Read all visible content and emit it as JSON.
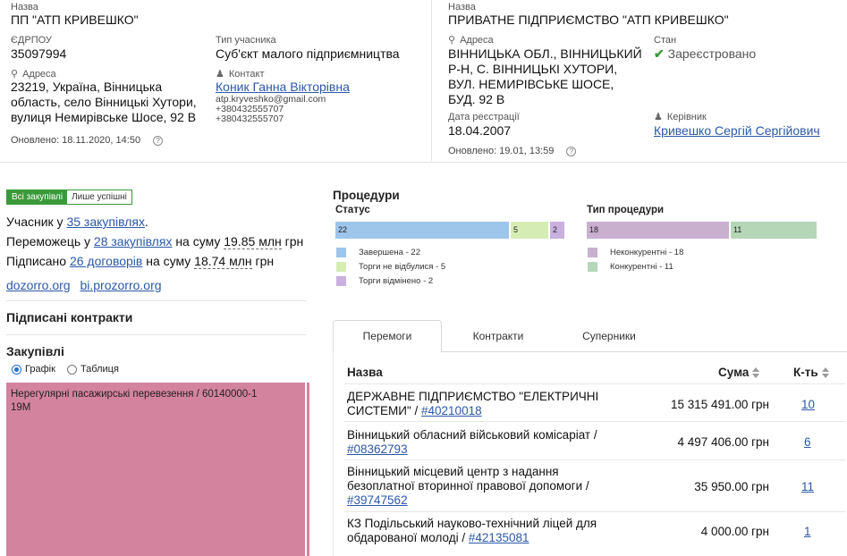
{
  "left_entity": {
    "name_label": "Назва",
    "name": "ПП \"АТП КРИВЕШКО\"",
    "edrpou_label": "ЄДРПОУ",
    "edrpou": "35097994",
    "participant_type_label": "Тип учасника",
    "participant_type": "Суб'єкт малого підприємництва",
    "address_label": "Адреса",
    "address_lines": [
      "23219, Україна, Вінницька",
      "область, село Вінницькі Хутори,",
      "вулиця Немирівське Шосе, 92 В"
    ],
    "contact_label": "Контакт",
    "contact_name": "Коник Ганна Вікторівна",
    "contact_email": "atp.kryveshko@gmail.com",
    "contact_phone_1": "+380432555707",
    "contact_phone_2": "+380432555707",
    "updated": "Оновлено: 18.11.2020, 14:50"
  },
  "right_entity": {
    "name_label": "Назва",
    "name": "ПРИВАТНЕ ПІДПРИЄМСТВО \"АТП КРИВЕШКО\"",
    "address_label": "Адреса",
    "address_lines": [
      "ВІННИЦЬКА ОБЛ., ВІННИЦЬКИЙ",
      "Р-Н, С. ВІННИЦЬКІ ХУТОРИ,",
      "ВУЛ. НЕМИРІВСЬКЕ ШОСЕ,",
      "БУД. 92 В"
    ],
    "state_label": "Стан",
    "state": "Зареєстровано",
    "reg_date_label": "Дата реєстрації",
    "reg_date": "18.04.2007",
    "head_label": "Керівник",
    "head_name": "Кривешко Сергій Сергійович",
    "updated": "Оновлено: 19.01, 13:59"
  },
  "filter": {
    "all": "Всі закупівлі",
    "success": "Лише успішні"
  },
  "stats": {
    "participant_prefix": "Учасник у",
    "participant_link": "35 закупівлях",
    "participant_suffix": ".",
    "winner_prefix": "Переможець у",
    "winner_link": "28 закупівлях",
    "winner_mid": "на суму",
    "winner_sum": "19.85 млн",
    "winner_currency": "грн",
    "signed_prefix": "Підписано",
    "signed_link": "26 договорів",
    "signed_mid": "на суму",
    "signed_sum": "18.74 млн",
    "signed_currency": "грн"
  },
  "links": {
    "dozorro": "dozorro.org",
    "bi": "bi.prozorro.org"
  },
  "signed_contracts_title": "Підписані контракти",
  "procurements": {
    "title": "Закупівлі",
    "view_chart": "Графік",
    "view_table": "Таблиця",
    "block_label": "Нерегулярні пасажирські перевезення / 60140000-1",
    "block_value": "19M"
  },
  "procedures": {
    "title": "Процедури",
    "status_title": "Статус",
    "type_title": "Тип процедури"
  },
  "chart_data": [
    {
      "type": "bar",
      "title": "Статус",
      "categories": [
        "Завершена",
        "Торги не відбулися",
        "Торги відмінено"
      ],
      "values": [
        22,
        5,
        2
      ],
      "colors": [
        "#9ec5ea",
        "#d5edb4",
        "#c9b0de"
      ],
      "legend_placement": "bottom"
    },
    {
      "type": "bar",
      "title": "Тип процедури",
      "categories": [
        "Неконкурентні",
        "Конкурентні"
      ],
      "values": [
        18,
        11
      ],
      "colors": [
        "#c9b0cf",
        "#b6d6b8"
      ],
      "legend_placement": "bottom"
    }
  ],
  "tabs": [
    "Перемоги",
    "Контракти",
    "Суперники"
  ],
  "table": {
    "col_name": "Назва",
    "col_sum": "Сума",
    "col_count": "К-ть",
    "rows": [
      {
        "name_lines": [
          "ДЕРЖАВНЕ ПІДПРИЄМСТВО \"ЕЛЕКТРИЧНІ",
          "СИСТЕМИ\" /"
        ],
        "id": "#40210018",
        "sum": "15 315 491.00 грн",
        "count": "10"
      },
      {
        "name_lines": [
          "Вінницький обласний військовий комісаріат /"
        ],
        "id": "#08362793",
        "sum": "4 497 406.00 грн",
        "count": "6"
      },
      {
        "name_lines": [
          "Вінницький місцевий центр з надання",
          "безоплатної вторинної правової допомоги /"
        ],
        "id": "#39747562",
        "sum": "35 950.00 грн",
        "count": "11"
      },
      {
        "name_lines": [
          "КЗ Подільський науково-технічний ліцей для",
          "обдарованої молоді /"
        ],
        "id": "#42135081",
        "sum": "4 000.00 грн",
        "count": "1"
      }
    ]
  },
  "colors": {
    "accent_green": "#3a9a3a",
    "link": "#2b58a8",
    "treemap": "#d4839f"
  }
}
